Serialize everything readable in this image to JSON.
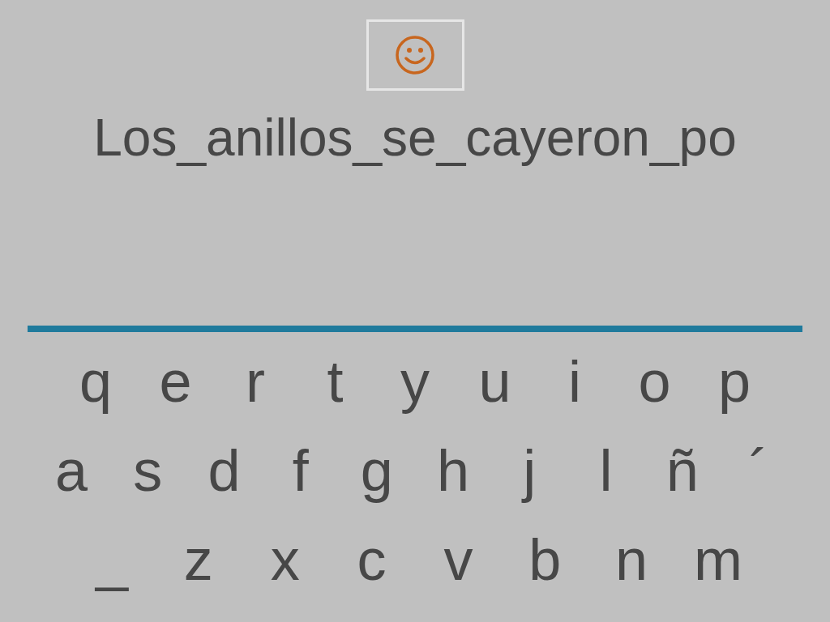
{
  "phrase": "Los_anillos_se_cayeron_po",
  "keyboard": {
    "rows": [
      {
        "keys": [
          "q",
          "e",
          "r",
          "t",
          "y",
          "u",
          "i",
          "o",
          "p"
        ]
      },
      {
        "keys": [
          "a",
          "s",
          "d",
          "f",
          "g",
          "h",
          "j",
          "l",
          "ñ",
          "´"
        ]
      },
      {
        "keys": [
          "_",
          "z",
          "x",
          "c",
          "v",
          "b",
          "n",
          "m"
        ]
      }
    ]
  }
}
